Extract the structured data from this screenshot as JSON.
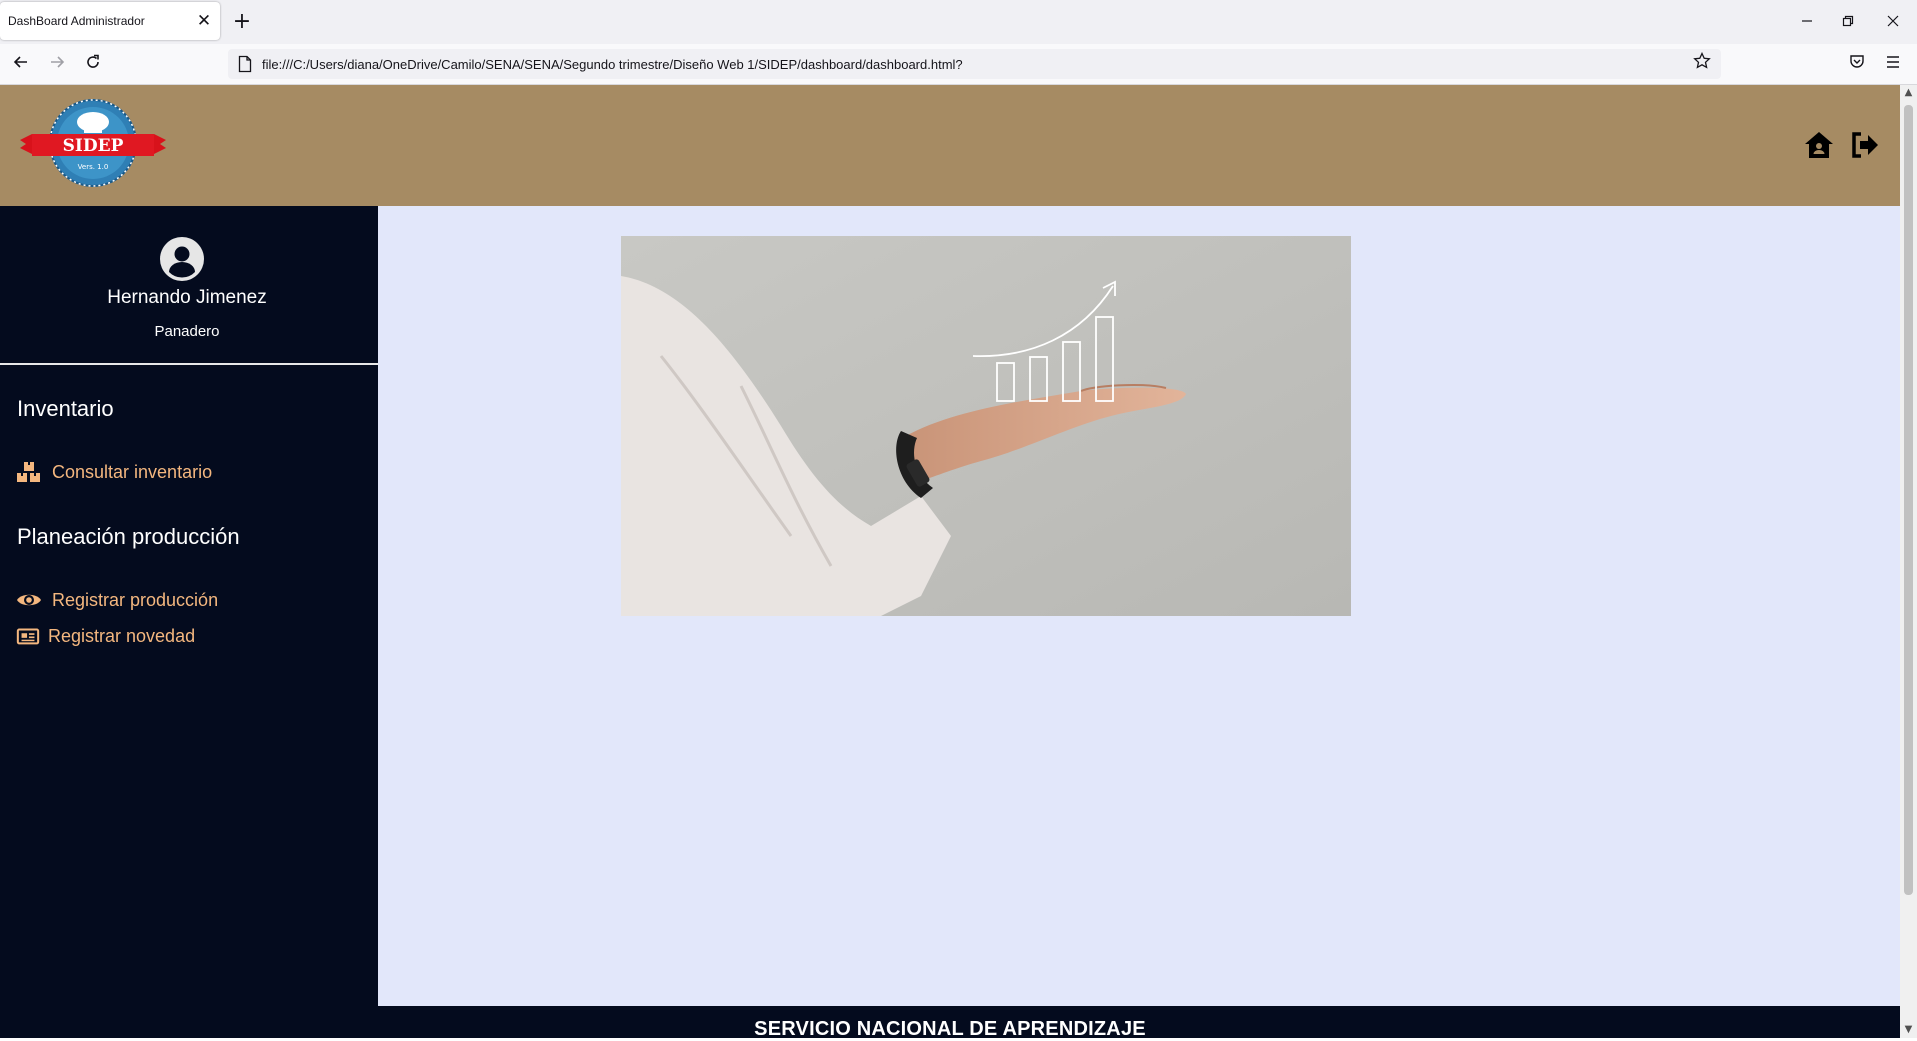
{
  "browser": {
    "tab_title": "DashBoard Administrador",
    "tab_close": "✕",
    "new_tab": "+",
    "url": "file:///C:/Users/diana/OneDrive/Camilo/SENA/SENA/Segundo trimestre/Diseño Web 1/SIDEP/dashboard/dashboard.html?",
    "icons": [
      "back-icon",
      "forward-icon",
      "reload-icon",
      "page-icon",
      "bookmark-star-icon",
      "pocket-icon",
      "menu-icon",
      "minimize-icon",
      "restore-icon",
      "close-icon"
    ]
  },
  "header": {
    "logo_text": "SIDEP",
    "logo_version": "Vers. 1.0",
    "icons": [
      "home-icon",
      "logout-icon"
    ],
    "bg_color": "#a68b63"
  },
  "sidebar": {
    "user_name": "Hernando Jimenez",
    "user_role": "Panadero",
    "sections": [
      {
        "title": "Inventario",
        "items": [
          {
            "label": "Consultar inventario",
            "icon": "boxes-icon"
          }
        ]
      },
      {
        "title": "Planeación producción",
        "items": [
          {
            "label": "Registrar producción",
            "icon": "eye-icon"
          },
          {
            "label": "Registrar novedad",
            "icon": "newspaper-icon"
          }
        ]
      }
    ],
    "bg_color": "#040b1e",
    "link_color": "#f4b77f"
  },
  "main": {
    "bg_color": "#e2e7fa",
    "hero_image": "hand-holding-growth-chart"
  },
  "footer": {
    "text": "SERVICIO NACIONAL DE APRENDIZAJE"
  }
}
